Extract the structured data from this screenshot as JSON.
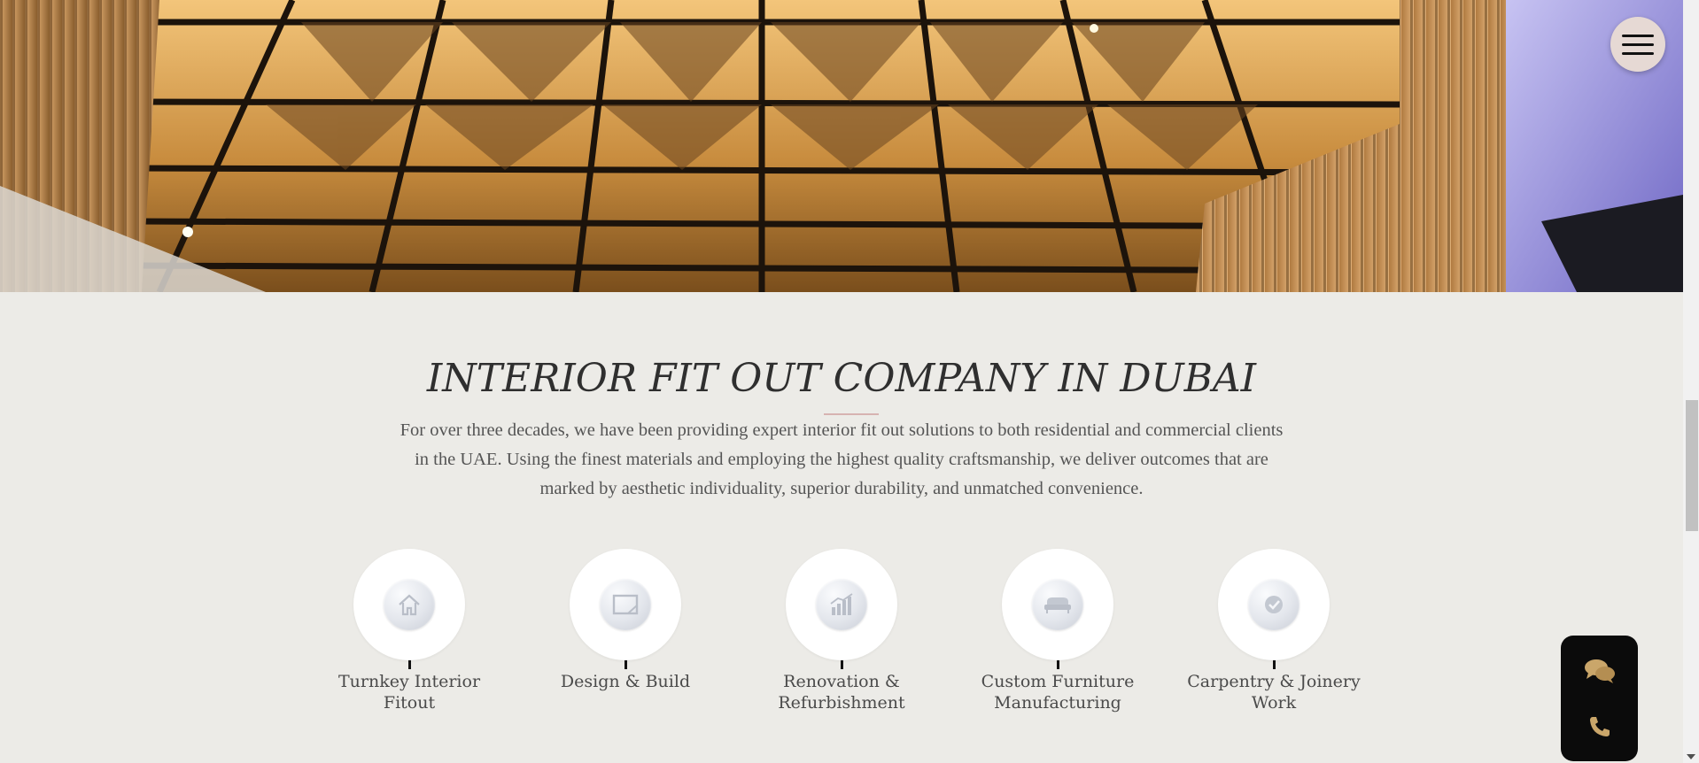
{
  "header": {
    "menu_icon": "hamburger-menu-icon"
  },
  "intro": {
    "title": "INTERIOR FIT OUT COMPANY IN DUBAI",
    "paragraph": "For over three decades, we have been providing expert interior fit out solutions to both residential and commercial clients in the UAE. Using the finest materials and employing the highest quality craftsmanship, we deliver outcomes that are marked by aesthetic individuality, superior durability, and unmatched convenience."
  },
  "services": [
    {
      "line1": "Turnkey Interior",
      "line2": "Fitout",
      "icon": "house-icon"
    },
    {
      "line1": "Design & Build",
      "line2": "",
      "icon": "frame-icon"
    },
    {
      "line1": "Renovation &",
      "line2": "Refurbishment",
      "icon": "bar-chart-icon"
    },
    {
      "line1": "Custom Furniture",
      "line2": "Manufacturing",
      "icon": "sofa-icon"
    },
    {
      "line1": "Carpentry & Joinery",
      "line2": "Work",
      "icon": "check-badge-icon"
    }
  ],
  "contact_widget": {
    "chat_icon": "chat-bubbles-icon",
    "phone_icon": "phone-icon"
  },
  "colors": {
    "background": "#ecebe7",
    "accent_rule": "#d7b3b1",
    "widget_bg": "#0b0b0b",
    "widget_icon": "#caa66a",
    "menu_bg": "#e6d9d4"
  }
}
